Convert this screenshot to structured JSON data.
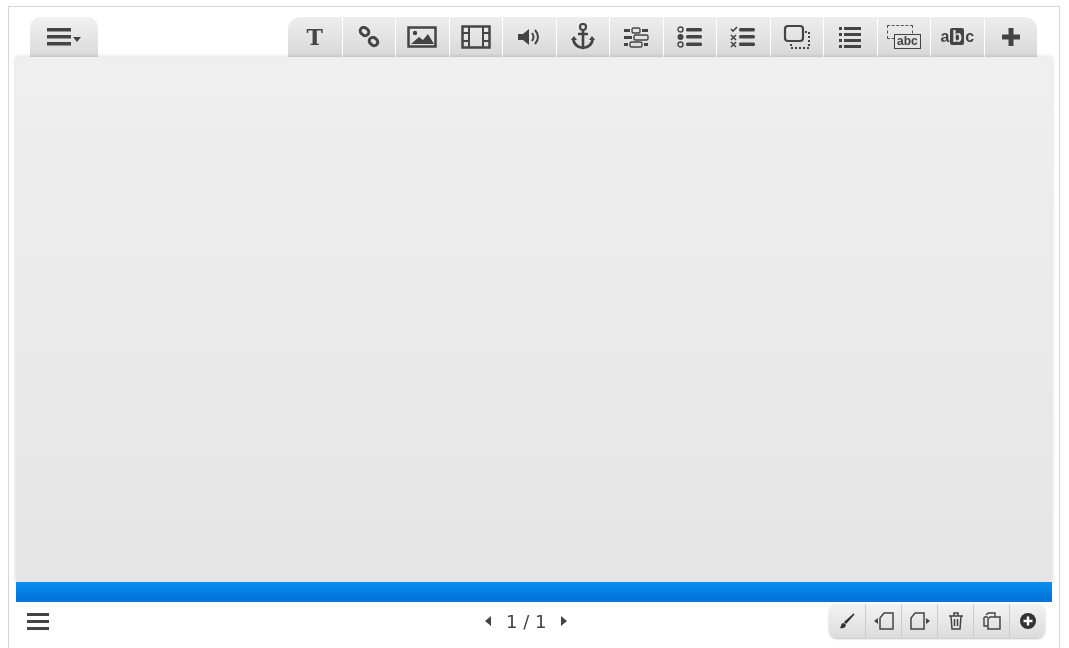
{
  "toolbar": [
    {
      "kind": "text",
      "label": "T"
    },
    {
      "kind": "link"
    },
    {
      "kind": "image"
    },
    {
      "kind": "video"
    },
    {
      "kind": "audio"
    },
    {
      "kind": "anchor"
    },
    {
      "kind": "fields"
    },
    {
      "kind": "radio"
    },
    {
      "kind": "checklist"
    },
    {
      "kind": "overlay"
    },
    {
      "kind": "list"
    },
    {
      "kind": "textbox",
      "label": "abc"
    },
    {
      "kind": "highlight",
      "label": "a",
      "boxed": "b",
      "after": "c"
    },
    {
      "kind": "add"
    }
  ],
  "pager": {
    "text": "1 / 1"
  },
  "page_tools": [
    {
      "kind": "brush"
    },
    {
      "kind": "page-before"
    },
    {
      "kind": "page-after"
    },
    {
      "kind": "trash"
    },
    {
      "kind": "copy"
    },
    {
      "kind": "add"
    }
  ]
}
